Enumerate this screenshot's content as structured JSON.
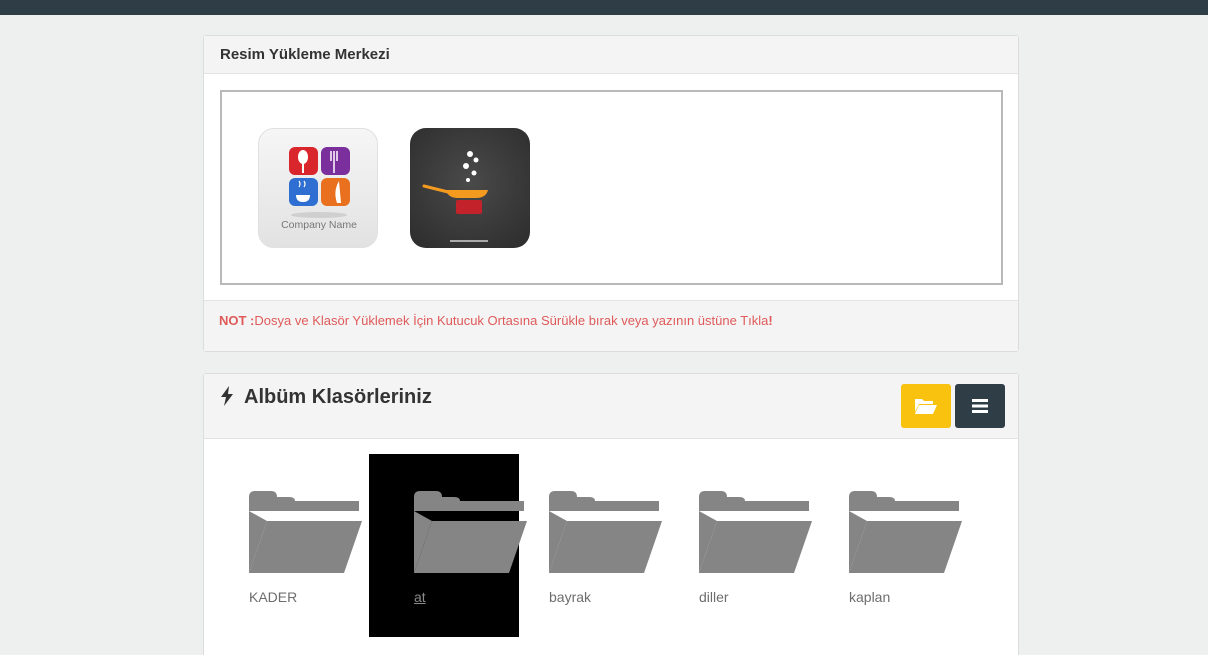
{
  "upload": {
    "title": "Resim Yükleme Merkezi",
    "thumb1_text": "Company Name",
    "note_prefix": "NOT :",
    "note_text": "Dosya ve Klasör Yüklemek İçin Kutucuk Ortasına Sürükle bırak veya yazının üstüne Tıkla",
    "note_suffix": "!"
  },
  "albums": {
    "title": "Albüm Klasörleriniz",
    "buttons": {
      "folder_icon": "folder-open-icon",
      "menu_icon": "menu-icon"
    },
    "folders": [
      {
        "name": "KADER",
        "active": false
      },
      {
        "name": "at",
        "active": true
      },
      {
        "name": "bayrak",
        "active": false
      },
      {
        "name": "diller",
        "active": false
      },
      {
        "name": "kaplan",
        "active": false
      }
    ]
  },
  "colors": {
    "topbar": "#2f3e46",
    "note_text": "#e05a5a",
    "folder_button": "#f9c20f",
    "menu_button": "#2f3e46",
    "folder_icon": "#858585"
  }
}
